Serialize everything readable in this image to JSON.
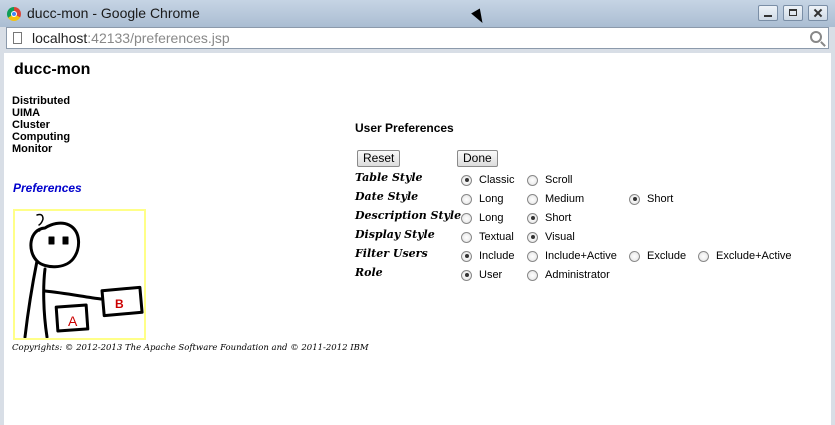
{
  "window": {
    "title": "ducc-mon - Google Chrome"
  },
  "address": {
    "host": "localhost",
    "rest": ":42133/preferences.jsp"
  },
  "app": {
    "title": "ducc-mon",
    "subtitle_lines": [
      "Distributed",
      "UIMA",
      "Cluster",
      "Computing",
      "Monitor"
    ],
    "nav_link": "Preferences",
    "copyright": "Copyrights: © 2012-2013 The Apache Software Foundation and © 2011-2012 IBM"
  },
  "prefs": {
    "title": "User Preferences",
    "reset_label": "Reset",
    "done_label": "Done",
    "rows": [
      {
        "label": "Table Style",
        "options": [
          {
            "label": "Classic",
            "checked": true
          },
          {
            "label": "Scroll",
            "checked": false
          }
        ]
      },
      {
        "label": "Date Style",
        "options": [
          {
            "label": "Long",
            "checked": false
          },
          {
            "label": "Medium",
            "checked": false
          },
          {
            "label": "Short",
            "checked": true
          }
        ]
      },
      {
        "label": "Description Style",
        "options": [
          {
            "label": "Long",
            "checked": false
          },
          {
            "label": "Short",
            "checked": true
          }
        ]
      },
      {
        "label": "Display Style",
        "options": [
          {
            "label": "Textual",
            "checked": false
          },
          {
            "label": "Visual",
            "checked": true
          }
        ]
      },
      {
        "label": "Filter Users",
        "options": [
          {
            "label": "Include",
            "checked": true
          },
          {
            "label": "Include+Active",
            "checked": false
          },
          {
            "label": "Exclude",
            "checked": false
          },
          {
            "label": "Exclude+Active",
            "checked": false
          }
        ]
      },
      {
        "label": "Role",
        "options": [
          {
            "label": "User",
            "checked": true
          },
          {
            "label": "Administrator",
            "checked": false
          }
        ]
      }
    ]
  },
  "logo": {
    "letters": [
      "A",
      "B"
    ],
    "letter_color": "#cc0000"
  }
}
